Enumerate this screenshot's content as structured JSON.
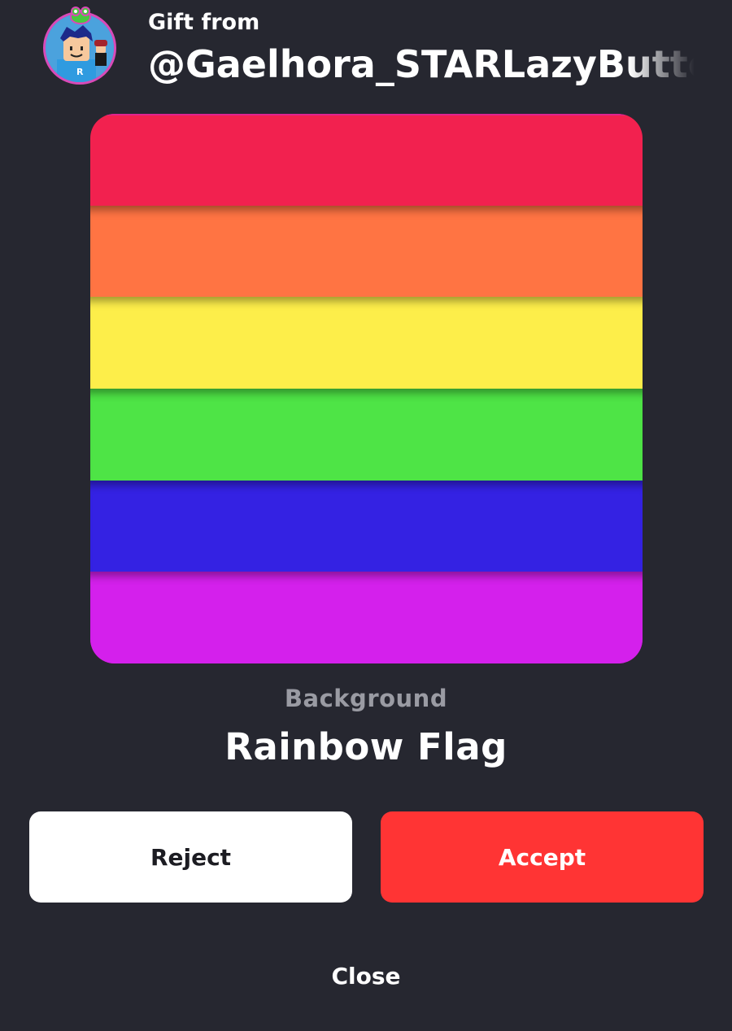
{
  "header": {
    "gift_from_label": "Gift from",
    "sender_name": "@Gaelhora_STARLazyButterfly"
  },
  "item": {
    "type_label": "Background",
    "name": "Rainbow Flag",
    "stripe_colors": [
      "#f2214f",
      "#ff7443",
      "#fdee4a",
      "#4ee446",
      "#3422e3",
      "#d420ec"
    ]
  },
  "actions": {
    "reject_label": "Reject",
    "accept_label": "Accept",
    "close_label": "Close"
  },
  "colors": {
    "background": "#262730",
    "accept": "#ff3434",
    "reject": "#ffffff",
    "muted_text": "#9a9ba3",
    "avatar_ring": "#d94ab8"
  }
}
